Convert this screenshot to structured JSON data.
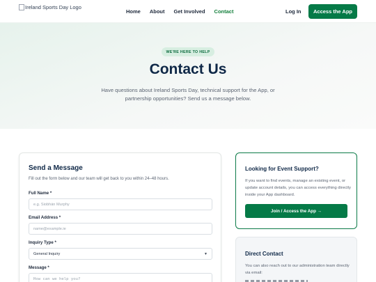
{
  "header": {
    "logo_alt": "Ireland Sports Day Logo",
    "nav": [
      "Home",
      "About",
      "Get Involved",
      "Contact"
    ],
    "active_nav": "Contact",
    "login_label": "Log In",
    "access_label": "Access the App"
  },
  "hero": {
    "badge": "WE'RE HERE TO HELP",
    "title": "Contact Us",
    "subtitle": "Have questions about Ireland Sports Day, technical support for the App, or partnership opportunities? Send us a message below."
  },
  "form": {
    "title": "Send a Message",
    "description": "Fill out the form below and our team will get back to you within 24–48 hours.",
    "full_name_label": "Full Name *",
    "full_name_placeholder": "e.g. Siobhán Murphy",
    "email_label": "Email Address *",
    "email_placeholder": "name@example.ie",
    "inquiry_label": "Inquiry Type *",
    "inquiry_value": "General Inquiry",
    "message_label": "Message *",
    "message_placeholder": "How can we help you?"
  },
  "support": {
    "title": "Looking for Event Support?",
    "text": "If you want to find events, manage an existing event, or update account details, you can access everything directly inside your App dashboard.",
    "button": "Join / Access the App →"
  },
  "direct": {
    "title": "Direct Contact",
    "text": "You can also reach out to our administration team directly via email:"
  },
  "colors": {
    "brand_green": "#057a47",
    "navy": "#0f2847",
    "active_nav": "#15803d"
  }
}
